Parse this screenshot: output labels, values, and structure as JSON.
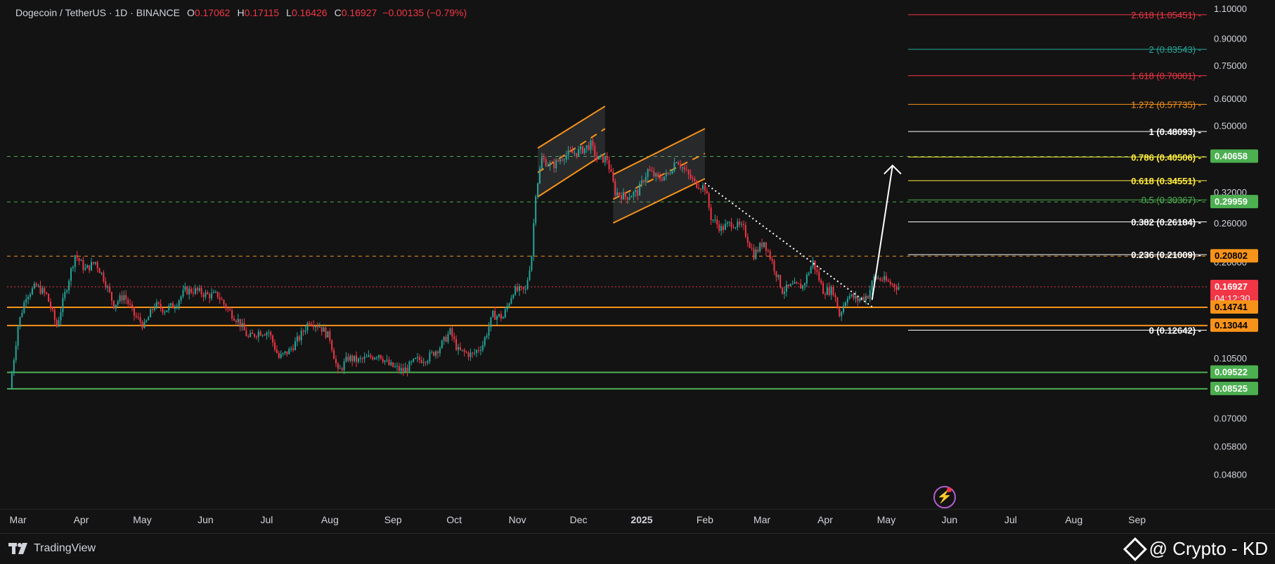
{
  "legend": {
    "symbol": "Dogecoin / TetherUS · 1D · BINANCE",
    "open_label": "O",
    "open": "0.17062",
    "high_label": "H",
    "high": "0.17115",
    "low_label": "L",
    "low": "0.16426",
    "close_label": "C",
    "close": "0.16927",
    "change": "−0.00135 (−0.79%)"
  },
  "footer": {
    "tradingview": "TradingView",
    "author": "@ Crypto - KD"
  },
  "icons": {
    "bolt": "lightning-bolt-icon",
    "logo": "tradingview-logo-icon",
    "brand": "binance-diamond-icon"
  },
  "colors": {
    "up": "#26a69a",
    "down": "#f23645",
    "orange": "#f7931a",
    "green": "#4caf50",
    "white": "#ffffff"
  },
  "chart_data": {
    "type": "candlestick",
    "scale": "log",
    "x_ticks": [
      "Mar",
      "Apr",
      "May",
      "Jun",
      "Jul",
      "Aug",
      "Sep",
      "Oct",
      "Nov",
      "Dec",
      "2025",
      "Feb",
      "Mar",
      "Apr",
      "May",
      "Jun",
      "Jul",
      "Aug",
      "Sep"
    ],
    "y_ticks": [
      "1.10000",
      "0.90000",
      "0.75000",
      "0.60000",
      "0.50000",
      "0.32000",
      "0.26000",
      "0.20000",
      "0.10500",
      "0.07000",
      "0.05800",
      "0.04800"
    ],
    "price_tags": [
      {
        "value": "0.40658",
        "color": "#4caf50",
        "kind": "green"
      },
      {
        "value": "0.29959",
        "color": "#4caf50",
        "kind": "green"
      },
      {
        "value": "0.20802",
        "color": "#f7931a",
        "kind": "orange"
      },
      {
        "value": "0.16927",
        "color": "#f23645",
        "kind": "current",
        "sub": "04:12:30"
      },
      {
        "value": "0.14741",
        "color": "#f7931a",
        "kind": "orange"
      },
      {
        "value": "0.13044",
        "color": "#f7931a",
        "kind": "orange"
      },
      {
        "value": "0.09522",
        "color": "#4caf50",
        "kind": "green"
      },
      {
        "value": "0.08525",
        "color": "#4caf50",
        "kind": "green"
      }
    ],
    "fib_levels": [
      {
        "label": "2.618 (1.05451)",
        "value": 1.05451,
        "color": "#f23645"
      },
      {
        "label": "2 (0.83543)",
        "value": 0.83543,
        "color": "#26a69a"
      },
      {
        "label": "1.618 (0.70001)",
        "value": 0.70001,
        "color": "#f23645"
      },
      {
        "label": "1.272 (0.57735)",
        "value": 0.57735,
        "color": "#f7931a"
      },
      {
        "label": "1 (0.48093)",
        "value": 0.48093,
        "color": "#ffffff"
      },
      {
        "label": "0.786 (0.40506)",
        "value": 0.40506,
        "color": "#ffeb3b"
      },
      {
        "label": "0.618 (0.34551)",
        "value": 0.34551,
        "color": "#ffeb3b"
      },
      {
        "label": "0.5 (0.30367)",
        "value": 0.30367,
        "color": "#4caf50"
      },
      {
        "label": "0.382 (0.26184)",
        "value": 0.26184,
        "color": "#ffffff"
      },
      {
        "label": "0.236 (0.21009)",
        "value": 0.21009,
        "color": "#ffffff"
      },
      {
        "label": "0 (0.12642)",
        "value": 0.12642,
        "color": "#ffffff"
      }
    ],
    "horizontal_lines": [
      {
        "value": 0.40658,
        "color": "#4caf50",
        "style": "dashed"
      },
      {
        "value": 0.29959,
        "color": "#4caf50",
        "style": "dashed"
      },
      {
        "value": 0.20802,
        "color": "#f7931a",
        "style": "dashed"
      },
      {
        "value": 0.16927,
        "color": "#f23645",
        "style": "dotted"
      },
      {
        "value": 0.14741,
        "color": "#f7931a",
        "style": "solid"
      },
      {
        "value": 0.13044,
        "color": "#f7931a",
        "style": "solid"
      },
      {
        "value": 0.09522,
        "color": "#4caf50",
        "style": "solid"
      },
      {
        "value": 0.08525,
        "color": "#4caf50",
        "style": "solid"
      }
    ],
    "price_path": [
      [
        "2024-02-26",
        0.085
      ],
      [
        "2024-03-01",
        0.13
      ],
      [
        "2024-03-05",
        0.16
      ],
      [
        "2024-03-10",
        0.17
      ],
      [
        "2024-03-15",
        0.16
      ],
      [
        "2024-03-20",
        0.13
      ],
      [
        "2024-03-25",
        0.17
      ],
      [
        "2024-03-29",
        0.21
      ],
      [
        "2024-04-03",
        0.19
      ],
      [
        "2024-04-08",
        0.2
      ],
      [
        "2024-04-12",
        0.18
      ],
      [
        "2024-04-17",
        0.15
      ],
      [
        "2024-04-22",
        0.16
      ],
      [
        "2024-04-27",
        0.14
      ],
      [
        "2024-05-02",
        0.13
      ],
      [
        "2024-05-07",
        0.15
      ],
      [
        "2024-05-12",
        0.145
      ],
      [
        "2024-05-17",
        0.15
      ],
      [
        "2024-05-22",
        0.165
      ],
      [
        "2024-05-27",
        0.165
      ],
      [
        "2024-06-02",
        0.16
      ],
      [
        "2024-06-07",
        0.16
      ],
      [
        "2024-06-12",
        0.145
      ],
      [
        "2024-06-17",
        0.135
      ],
      [
        "2024-06-22",
        0.12
      ],
      [
        "2024-06-27",
        0.125
      ],
      [
        "2024-07-02",
        0.125
      ],
      [
        "2024-07-07",
        0.105
      ],
      [
        "2024-07-12",
        0.11
      ],
      [
        "2024-07-17",
        0.12
      ],
      [
        "2024-07-22",
        0.135
      ],
      [
        "2024-07-27",
        0.13
      ],
      [
        "2024-08-01",
        0.12
      ],
      [
        "2024-08-05",
        0.095
      ],
      [
        "2024-08-10",
        0.105
      ],
      [
        "2024-08-15",
        0.103
      ],
      [
        "2024-08-20",
        0.105
      ],
      [
        "2024-08-25",
        0.108
      ],
      [
        "2024-08-30",
        0.1
      ],
      [
        "2024-09-06",
        0.096
      ],
      [
        "2024-09-12",
        0.103
      ],
      [
        "2024-09-18",
        0.105
      ],
      [
        "2024-09-24",
        0.113
      ],
      [
        "2024-09-29",
        0.125
      ],
      [
        "2024-10-03",
        0.11
      ],
      [
        "2024-10-10",
        0.107
      ],
      [
        "2024-10-15",
        0.115
      ],
      [
        "2024-10-20",
        0.14
      ],
      [
        "2024-10-25",
        0.138
      ],
      [
        "2024-10-30",
        0.165
      ],
      [
        "2024-11-05",
        0.165
      ],
      [
        "2024-11-08",
        0.21
      ],
      [
        "2024-11-10",
        0.32
      ],
      [
        "2024-11-13",
        0.4
      ],
      [
        "2024-11-18",
        0.38
      ],
      [
        "2024-11-24",
        0.41
      ],
      [
        "2024-12-01",
        0.42
      ],
      [
        "2024-12-07",
        0.44
      ],
      [
        "2024-12-10",
        0.4
      ],
      [
        "2024-12-15",
        0.4
      ],
      [
        "2024-12-19",
        0.32
      ],
      [
        "2024-12-24",
        0.31
      ],
      [
        "2024-12-30",
        0.32
      ],
      [
        "2025-01-04",
        0.37
      ],
      [
        "2025-01-09",
        0.35
      ],
      [
        "2025-01-14",
        0.36
      ],
      [
        "2025-01-18",
        0.4
      ],
      [
        "2025-01-22",
        0.37
      ],
      [
        "2025-01-27",
        0.34
      ],
      [
        "2025-02-01",
        0.33
      ],
      [
        "2025-02-04",
        0.27
      ],
      [
        "2025-02-09",
        0.25
      ],
      [
        "2025-02-14",
        0.26
      ],
      [
        "2025-02-20",
        0.25
      ],
      [
        "2025-02-25",
        0.21
      ],
      [
        "2025-03-02",
        0.23
      ],
      [
        "2025-03-06",
        0.2
      ],
      [
        "2025-03-11",
        0.165
      ],
      [
        "2025-03-16",
        0.17
      ],
      [
        "2025-03-21",
        0.17
      ],
      [
        "2025-03-26",
        0.2
      ],
      [
        "2025-03-31",
        0.165
      ],
      [
        "2025-04-05",
        0.165
      ],
      [
        "2025-04-08",
        0.14
      ],
      [
        "2025-04-12",
        0.16
      ],
      [
        "2025-04-17",
        0.155
      ],
      [
        "2025-04-22",
        0.16
      ],
      [
        "2025-04-25",
        0.18
      ],
      [
        "2025-04-29",
        0.178
      ],
      [
        "2025-05-03",
        0.173
      ],
      [
        "2025-05-07",
        0.169
      ]
    ],
    "channels": [
      {
        "x0": "2024-11-11",
        "x1": "2024-12-14",
        "top": [
          0.43,
          0.57
        ],
        "bottom": [
          0.31,
          0.415
        ],
        "mid": [
          0.365,
          0.49
        ]
      },
      {
        "x0": "2024-12-18",
        "x1": "2025-02-01",
        "top": [
          0.36,
          0.49
        ],
        "bottom": [
          0.26,
          0.35
        ],
        "mid": [
          0.305,
          0.415
        ]
      }
    ],
    "trendline": {
      "x0": "2025-02-01",
      "y0": 0.34,
      "x1": "2025-04-24",
      "y1": 0.148,
      "style": "dotted"
    },
    "arrow": {
      "x0": "2025-04-24",
      "y0": 0.155,
      "x1": "2025-05-02",
      "y1": 0.405
    }
  }
}
